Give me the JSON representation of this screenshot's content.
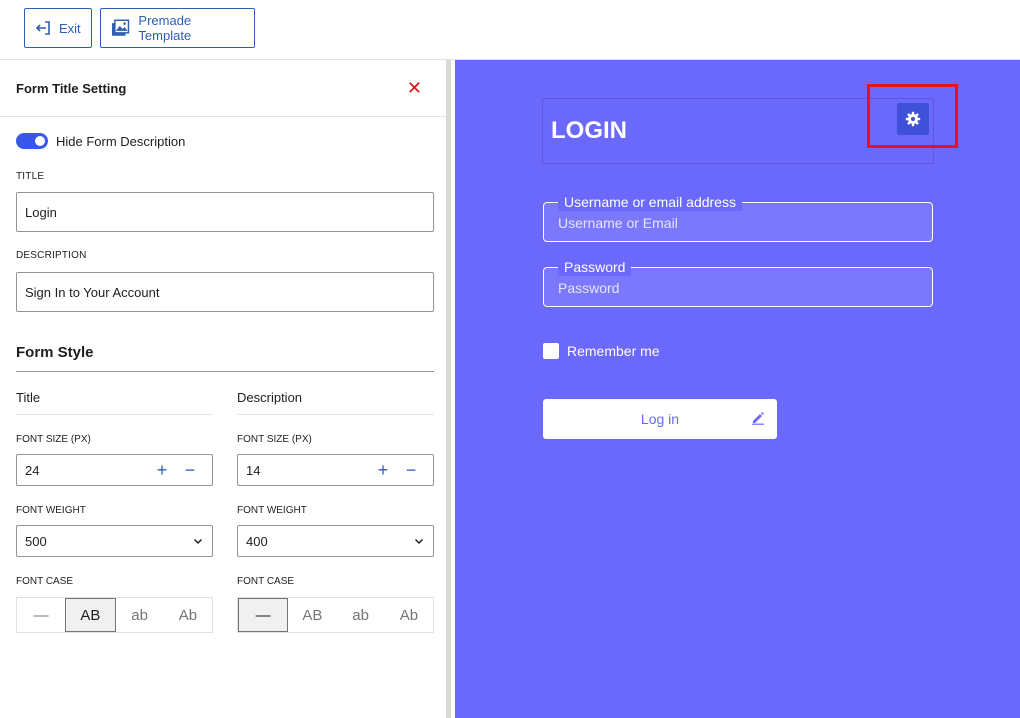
{
  "toolbar": {
    "exit_label": "Exit",
    "premade_label": "Premade Template"
  },
  "panel": {
    "title": "Form Title Setting",
    "close_glyph": "✕",
    "toggle_label": "Hide Form Description",
    "toggle_on": true,
    "title_label": "TITLE",
    "title_value": "Login",
    "description_label": "DESCRIPTION",
    "description_value": "Sign In to Your Account",
    "form_style_heading": "Form Style",
    "columns": {
      "title": {
        "heading": "Title",
        "font_size_label": "FONT SIZE (PX)",
        "font_size_value": "24",
        "font_weight_label": "FONT WEIGHT",
        "font_weight_value": "500",
        "font_case_label": "FONT CASE",
        "selected_case": "AB"
      },
      "description": {
        "heading": "Description",
        "font_size_label": "FONT SIZE (PX)",
        "font_size_value": "14",
        "font_weight_label": "FONT WEIGHT",
        "font_weight_value": "400",
        "font_case_label": "FONT CASE",
        "selected_case": "none"
      }
    },
    "case_options": {
      "none": "—",
      "upper": "AB",
      "lower": "ab",
      "capitalize": "Ab"
    }
  },
  "preview": {
    "form_title": "LOGIN",
    "username_label": "Username or email address",
    "username_placeholder": "Username or Email",
    "password_label": "Password",
    "password_placeholder": "Password",
    "remember_label": "Remember me",
    "login_button": "Log in"
  },
  "colors": {
    "accent": "#2f5fb3",
    "preview_bg": "#6b68fc",
    "highlight": "#e5111c",
    "toggle": "#3858e9"
  },
  "icons": {
    "exit": "exit-icon",
    "premade": "image-gallery-icon",
    "close": "close-icon",
    "gear": "gear-icon",
    "edit": "pencil-icon",
    "chevron": "chevron-down-icon"
  }
}
